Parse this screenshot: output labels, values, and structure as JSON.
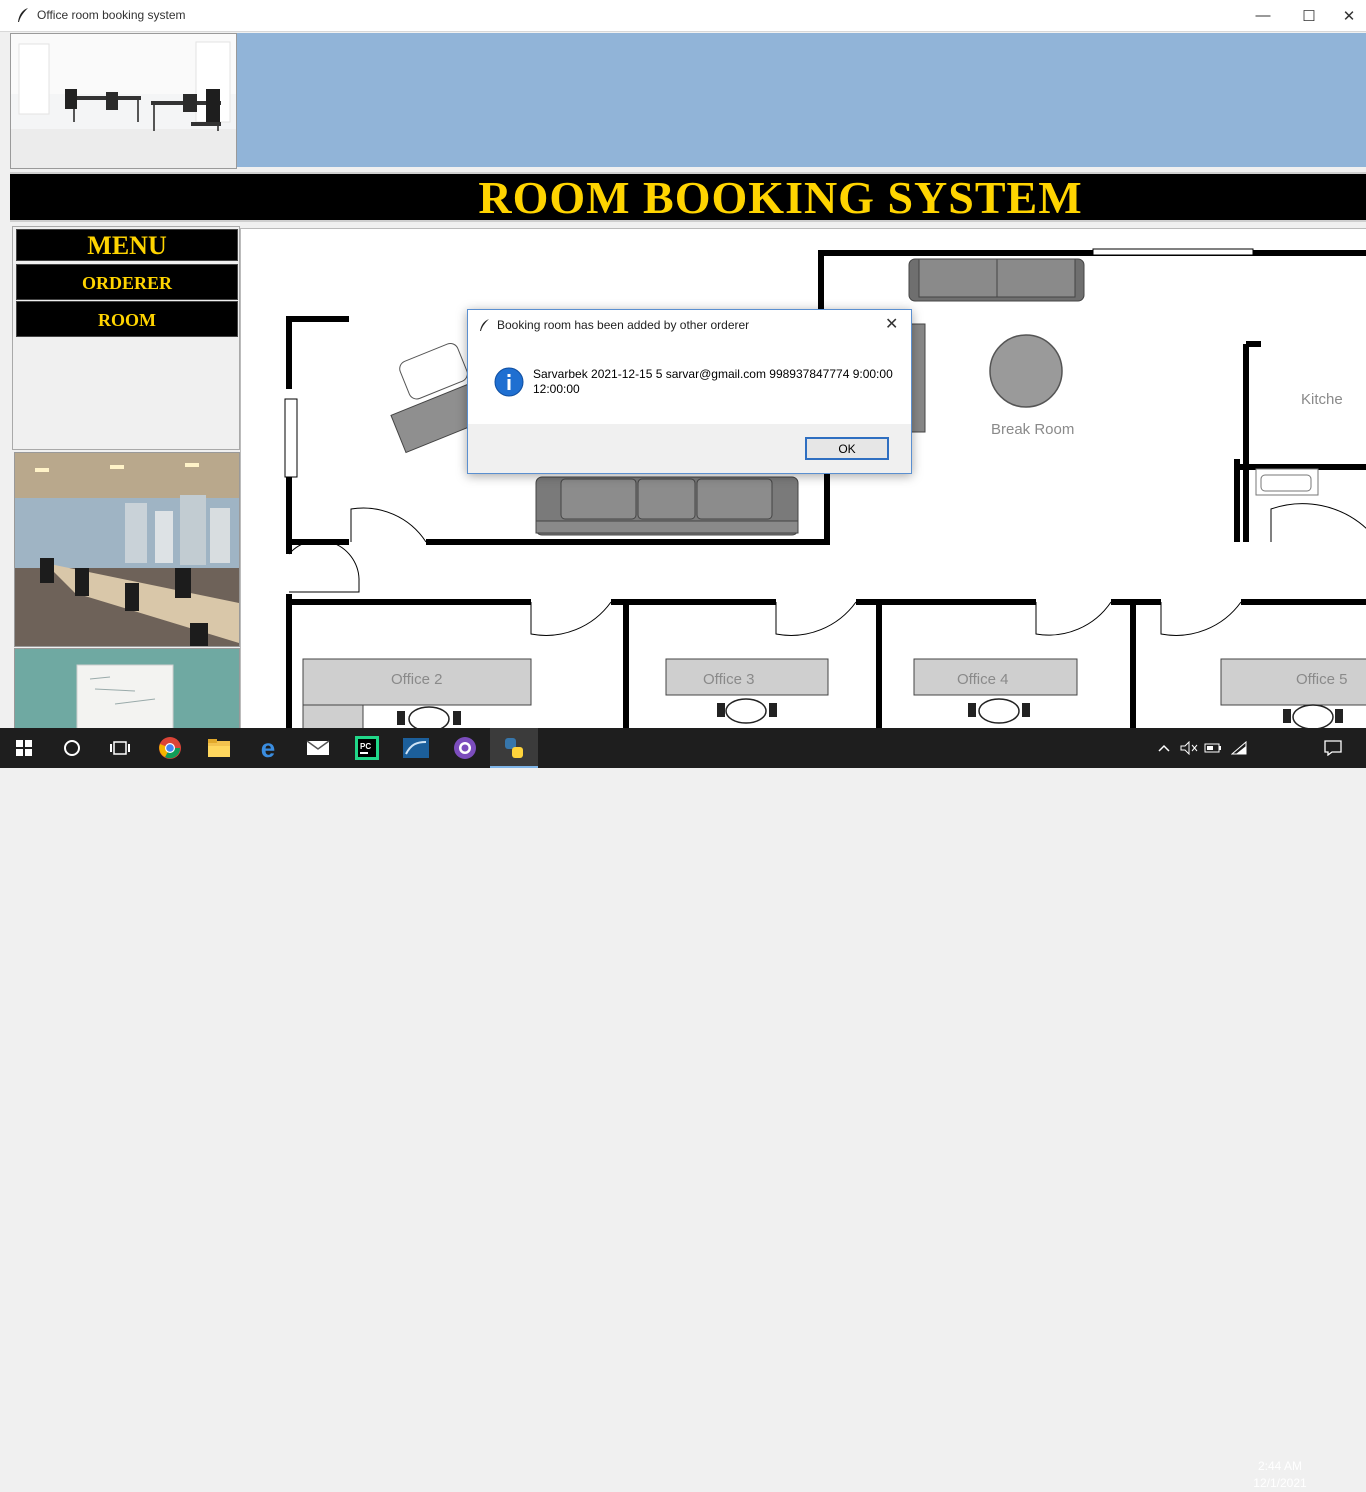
{
  "window": {
    "title": "Office room booking system",
    "minimize_glyph": "—",
    "maximize_glyph": "☐",
    "close_glyph": "✕"
  },
  "header": {
    "banner_text": "ROOM BOOKING SYSTEM",
    "header_bg": "#91b4d8",
    "banner_bg": "#000000",
    "banner_color": "#ffd400"
  },
  "menu": {
    "title": "MENU",
    "items": [
      "ORDERER",
      "ROOM"
    ]
  },
  "floorplan": {
    "room_labels": [
      "Break Room",
      "Kitche",
      "Office 2",
      "Office 3",
      "Office 4",
      "Office 5"
    ]
  },
  "dialog": {
    "title": "Booking room has been added by other orderer",
    "icon": "info-icon",
    "message_line1": "Sarvarbek 2021-12-15 5 sarvar@gmail.com 998937847774 9:00:00",
    "message_line2": "12:00:00",
    "ok_label": "OK",
    "close_glyph": "✕"
  },
  "taskbar": {
    "apps": [
      "start-icon",
      "cortana-icon",
      "task-view-icon",
      "chrome-icon",
      "file-explorer-icon",
      "edge-icon",
      "mail-icon",
      "pycharm-icon",
      "mysql-workbench-icon",
      "github-desktop-icon",
      "python-icon"
    ],
    "time": "2:44 AM",
    "date": "12/1/2021"
  }
}
